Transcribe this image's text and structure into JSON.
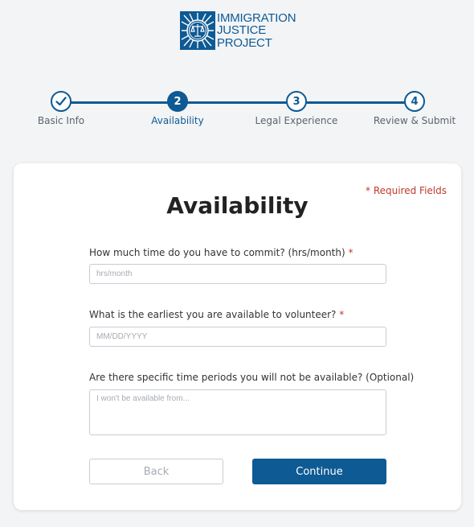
{
  "logo": {
    "line1": "IMMIGRATION",
    "line2": "JUSTICE",
    "line3": "PROJECT"
  },
  "stepper": {
    "steps": [
      {
        "label": "Basic Info",
        "number": "",
        "state": "complete"
      },
      {
        "label": "Availability",
        "number": "2",
        "state": "active"
      },
      {
        "label": "Legal Experience",
        "number": "3",
        "state": "upcoming"
      },
      {
        "label": "Review & Submit",
        "number": "4",
        "state": "upcoming"
      }
    ]
  },
  "form": {
    "required_note": "* Required Fields",
    "title": "Availability",
    "hours": {
      "label": "How much time do you have to commit? (hrs/month)",
      "required_mark": "*",
      "placeholder": "hrs/month",
      "value": ""
    },
    "earliest": {
      "label": "What is the earliest you are available to volunteer?",
      "required_mark": "*",
      "placeholder": "MM/DD/YYYY",
      "value": ""
    },
    "unavailable": {
      "label": "Are there specific time periods you will not be available? (Optional)",
      "placeholder": "I won't be available from...",
      "value": ""
    },
    "back_label": "Back",
    "continue_label": "Continue"
  },
  "colors": {
    "brand": "#0e5a94",
    "required": "#c0392b",
    "background": "#f3f4f6"
  }
}
